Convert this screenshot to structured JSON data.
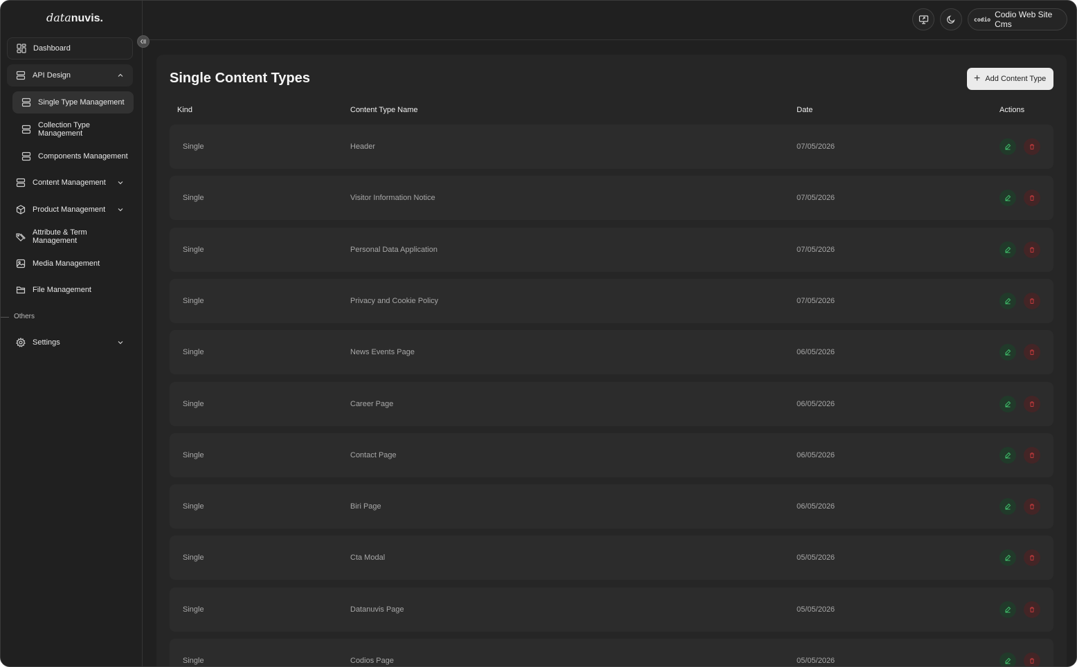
{
  "brand": {
    "logo_thin": "data",
    "logo_bold": "nuvis."
  },
  "sidebar": {
    "items": [
      {
        "label": "Dashboard",
        "icon": "dashboard-icon"
      },
      {
        "label": "API Design",
        "icon": "stack-icon"
      },
      {
        "label": "Single Type Management",
        "icon": "stack-icon"
      },
      {
        "label": "Collection Type Management",
        "icon": "stack-icon"
      },
      {
        "label": "Components Management",
        "icon": "stack-icon"
      },
      {
        "label": "Content Management",
        "icon": "stack-icon"
      },
      {
        "label": "Product Management",
        "icon": "box-icon"
      },
      {
        "label": "Attribute & Term Management",
        "icon": "tags-icon"
      },
      {
        "label": "Media Management",
        "icon": "image-icon"
      },
      {
        "label": "File Management",
        "icon": "folder-icon"
      },
      {
        "label": "Settings",
        "icon": "gear-icon"
      }
    ],
    "section_others": "Others"
  },
  "topbar": {
    "account_brand": "codio",
    "account_label": "Codio Web Site Cms"
  },
  "main": {
    "title": "Single Content Types",
    "add_button": "Add Content Type",
    "columns": {
      "kind": "Kind",
      "name": "Content Type Name",
      "date": "Date",
      "actions": "Actions"
    },
    "rows": [
      {
        "kind": "Single",
        "name": "Header",
        "date": "07/05/2026"
      },
      {
        "kind": "Single",
        "name": "Visitor Information Notice",
        "date": "07/05/2026"
      },
      {
        "kind": "Single",
        "name": "Personal Data Application",
        "date": "07/05/2026"
      },
      {
        "kind": "Single",
        "name": "Privacy and Cookie Policy",
        "date": "07/05/2026"
      },
      {
        "kind": "Single",
        "name": "News Events Page",
        "date": "06/05/2026"
      },
      {
        "kind": "Single",
        "name": "Career Page",
        "date": "06/05/2026"
      },
      {
        "kind": "Single",
        "name": "Contact Page",
        "date": "06/05/2026"
      },
      {
        "kind": "Single",
        "name": "Biri Page",
        "date": "06/05/2026"
      },
      {
        "kind": "Single",
        "name": "Cta Modal",
        "date": "05/05/2026"
      },
      {
        "kind": "Single",
        "name": "Datanuvis Page",
        "date": "05/05/2026"
      },
      {
        "kind": "Single",
        "name": "Codios Page",
        "date": "05/05/2026"
      }
    ]
  },
  "colors": {
    "edit": "#3fbf6a",
    "delete": "#c0393b",
    "background": "#202020"
  }
}
